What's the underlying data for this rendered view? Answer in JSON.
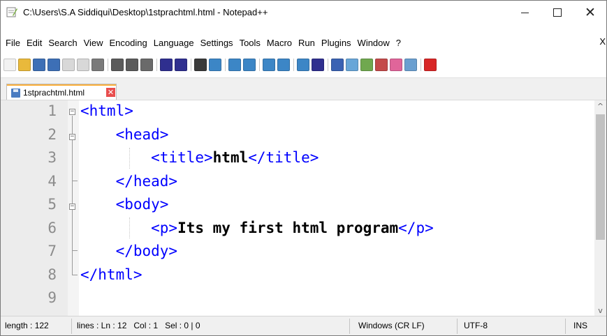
{
  "window": {
    "title": "C:\\Users\\S.A Siddiqui\\Desktop\\1stprachtml.html - Notepad++",
    "minimize_glyph": "—",
    "close_glyph": "✕"
  },
  "menu": {
    "items": [
      "File",
      "Edit",
      "Search",
      "View",
      "Encoding",
      "Language",
      "Settings",
      "Tools",
      "Macro",
      "Run",
      "Plugins",
      "Window",
      "?"
    ],
    "close_doc": "X"
  },
  "toolbar": {
    "icons": [
      {
        "name": "new-file-icon",
        "color": "#f2f2f2"
      },
      {
        "name": "open-file-icon",
        "color": "#e9b93b"
      },
      {
        "name": "save-icon",
        "color": "#3d6fb6"
      },
      {
        "name": "save-all-icon",
        "color": "#3d6fb6"
      },
      {
        "name": "close-icon",
        "color": "#d8d8d8"
      },
      {
        "name": "close-all-icon",
        "color": "#d8d8d8"
      },
      {
        "name": "print-icon",
        "color": "#7a7a7a"
      },
      {
        "sep": true
      },
      {
        "name": "cut-icon",
        "color": "#5b5b5b"
      },
      {
        "name": "copy-icon",
        "color": "#5b5b5b"
      },
      {
        "name": "paste-icon",
        "color": "#6a6a6a"
      },
      {
        "sep": true
      },
      {
        "name": "undo-icon",
        "color": "#2f2f8f"
      },
      {
        "name": "redo-icon",
        "color": "#2f2f8f"
      },
      {
        "sep": true
      },
      {
        "name": "find-icon",
        "color": "#3a3a3a"
      },
      {
        "name": "replace-icon",
        "color": "#3c86c6"
      },
      {
        "sep": true
      },
      {
        "name": "zoom-in-icon",
        "color": "#3c86c6"
      },
      {
        "name": "zoom-out-icon",
        "color": "#3c86c6"
      },
      {
        "sep": true
      },
      {
        "name": "sync-vertical-icon",
        "color": "#3c86c6"
      },
      {
        "name": "sync-horizontal-icon",
        "color": "#3c86c6"
      },
      {
        "sep": true
      },
      {
        "name": "word-wrap-icon",
        "color": "#3c86c6"
      },
      {
        "name": "show-all-chars-icon",
        "color": "#2f2f8f"
      },
      {
        "sep": true
      },
      {
        "name": "indent-guide-icon",
        "color": "#3a62b3"
      },
      {
        "name": "user-language-icon",
        "color": "#68a6d8"
      },
      {
        "name": "doc-map-icon",
        "color": "#70a84f"
      },
      {
        "name": "function-list-icon",
        "color": "#c44a4a"
      },
      {
        "name": "folder-workspace-icon",
        "color": "#e0659a"
      },
      {
        "name": "monitoring-icon",
        "color": "#6a9fd0"
      },
      {
        "sep": true
      },
      {
        "name": "record-macro-icon",
        "color": "#d82626"
      }
    ]
  },
  "tab": {
    "label": "1stprachtml.html",
    "close_glyph": "✕"
  },
  "editor": {
    "line_numbers": [
      "1",
      "2",
      "3",
      "4",
      "5",
      "6",
      "7",
      "8",
      "9"
    ],
    "lines": [
      [
        {
          "t": "tag",
          "v": "<html>"
        }
      ],
      [
        {
          "t": "tag",
          "v": "    <head>"
        }
      ],
      [
        {
          "t": "tag",
          "v": "        <title>"
        },
        {
          "t": "txt",
          "v": "html"
        },
        {
          "t": "tag",
          "v": "</title>"
        }
      ],
      [
        {
          "t": "tag",
          "v": "    </head>"
        }
      ],
      [
        {
          "t": "tag",
          "v": "    <body>"
        }
      ],
      [
        {
          "t": "tag",
          "v": "        <p>"
        },
        {
          "t": "txt",
          "v": "Its my first html program"
        },
        {
          "t": "tag",
          "v": "</p>"
        }
      ],
      [
        {
          "t": "tag",
          "v": "    </body>"
        }
      ],
      [
        {
          "t": "tag",
          "v": "</html>"
        }
      ],
      []
    ],
    "scroll_up": "^",
    "scroll_down": "v"
  },
  "status": {
    "length": "length : 122",
    "lines_pos": "lines : Ln : 12   Col : 1   Sel : 0 | 0",
    "eol": "Windows (CR LF)",
    "encoding": "UTF-8",
    "mode": "INS"
  }
}
